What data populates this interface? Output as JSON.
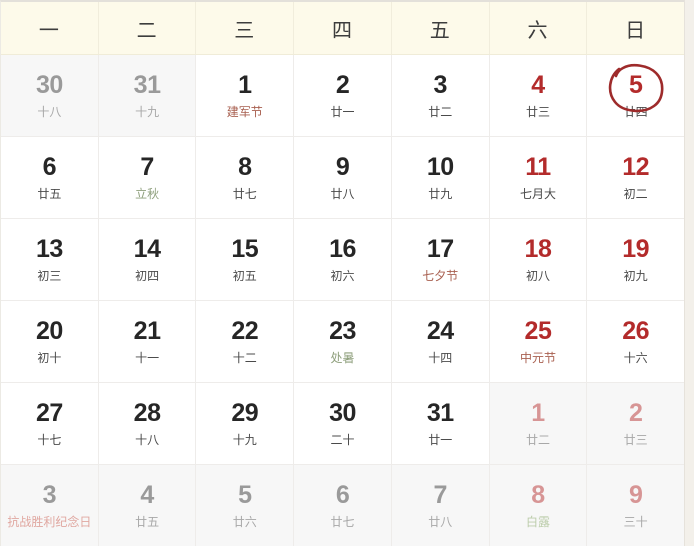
{
  "colors": {
    "header_bg": "#fdfaea",
    "cell_bg": "#ffffff",
    "other_month_bg": "#f7f7f7",
    "weekday_text": "#3d3d3d",
    "day_text": "#262626",
    "weekend_day_text": "#b32b2b",
    "other_month_day_text": "#9a9a9a",
    "other_month_weekend_text": "#d79595",
    "lunar_text": "#4a4a4a",
    "festival_text": "#a85f4f",
    "solar_term_text": "#8fa07d",
    "highlight_circle": "#9e2b2b",
    "grid_line": "#eeecea",
    "page_bg": "#f3f0ea"
  },
  "header": {
    "weekdays": [
      {
        "label": "一",
        "weekend": false
      },
      {
        "label": "二",
        "weekend": false
      },
      {
        "label": "三",
        "weekend": false
      },
      {
        "label": "四",
        "weekend": false
      },
      {
        "label": "五",
        "weekend": false
      },
      {
        "label": "六",
        "weekend": true
      },
      {
        "label": "日",
        "weekend": true
      }
    ]
  },
  "weeks": [
    [
      {
        "day": "30",
        "sub": "十八",
        "sub_type": "lunar",
        "other_month": true,
        "weekend": false,
        "today": false
      },
      {
        "day": "31",
        "sub": "十九",
        "sub_type": "lunar",
        "other_month": true,
        "weekend": false,
        "today": false
      },
      {
        "day": "1",
        "sub": "建军节",
        "sub_type": "festival",
        "other_month": false,
        "weekend": false,
        "today": false
      },
      {
        "day": "2",
        "sub": "廿一",
        "sub_type": "lunar",
        "other_month": false,
        "weekend": false,
        "today": false
      },
      {
        "day": "3",
        "sub": "廿二",
        "sub_type": "lunar",
        "other_month": false,
        "weekend": false,
        "today": false
      },
      {
        "day": "4",
        "sub": "廿三",
        "sub_type": "lunar",
        "other_month": false,
        "weekend": true,
        "today": false
      },
      {
        "day": "5",
        "sub": "廿四",
        "sub_type": "lunar",
        "other_month": false,
        "weekend": true,
        "today": true
      }
    ],
    [
      {
        "day": "6",
        "sub": "廿五",
        "sub_type": "lunar",
        "other_month": false,
        "weekend": false,
        "today": false
      },
      {
        "day": "7",
        "sub": "立秋",
        "sub_type": "term",
        "other_month": false,
        "weekend": false,
        "today": false
      },
      {
        "day": "8",
        "sub": "廿七",
        "sub_type": "lunar",
        "other_month": false,
        "weekend": false,
        "today": false
      },
      {
        "day": "9",
        "sub": "廿八",
        "sub_type": "lunar",
        "other_month": false,
        "weekend": false,
        "today": false
      },
      {
        "day": "10",
        "sub": "廿九",
        "sub_type": "lunar",
        "other_month": false,
        "weekend": false,
        "today": false
      },
      {
        "day": "11",
        "sub": "七月大",
        "sub_type": "lunar",
        "other_month": false,
        "weekend": true,
        "today": false
      },
      {
        "day": "12",
        "sub": "初二",
        "sub_type": "lunar",
        "other_month": false,
        "weekend": true,
        "today": false
      }
    ],
    [
      {
        "day": "13",
        "sub": "初三",
        "sub_type": "lunar",
        "other_month": false,
        "weekend": false,
        "today": false
      },
      {
        "day": "14",
        "sub": "初四",
        "sub_type": "lunar",
        "other_month": false,
        "weekend": false,
        "today": false
      },
      {
        "day": "15",
        "sub": "初五",
        "sub_type": "lunar",
        "other_month": false,
        "weekend": false,
        "today": false
      },
      {
        "day": "16",
        "sub": "初六",
        "sub_type": "lunar",
        "other_month": false,
        "weekend": false,
        "today": false
      },
      {
        "day": "17",
        "sub": "七夕节",
        "sub_type": "festival",
        "other_month": false,
        "weekend": false,
        "today": false
      },
      {
        "day": "18",
        "sub": "初八",
        "sub_type": "lunar",
        "other_month": false,
        "weekend": true,
        "today": false
      },
      {
        "day": "19",
        "sub": "初九",
        "sub_type": "lunar",
        "other_month": false,
        "weekend": true,
        "today": false
      }
    ],
    [
      {
        "day": "20",
        "sub": "初十",
        "sub_type": "lunar",
        "other_month": false,
        "weekend": false,
        "today": false
      },
      {
        "day": "21",
        "sub": "十一",
        "sub_type": "lunar",
        "other_month": false,
        "weekend": false,
        "today": false
      },
      {
        "day": "22",
        "sub": "十二",
        "sub_type": "lunar",
        "other_month": false,
        "weekend": false,
        "today": false
      },
      {
        "day": "23",
        "sub": "处暑",
        "sub_type": "term",
        "other_month": false,
        "weekend": false,
        "today": false
      },
      {
        "day": "24",
        "sub": "十四",
        "sub_type": "lunar",
        "other_month": false,
        "weekend": false,
        "today": false
      },
      {
        "day": "25",
        "sub": "中元节",
        "sub_type": "festival",
        "other_month": false,
        "weekend": true,
        "today": false
      },
      {
        "day": "26",
        "sub": "十六",
        "sub_type": "lunar",
        "other_month": false,
        "weekend": true,
        "today": false
      }
    ],
    [
      {
        "day": "27",
        "sub": "十七",
        "sub_type": "lunar",
        "other_month": false,
        "weekend": false,
        "today": false
      },
      {
        "day": "28",
        "sub": "十八",
        "sub_type": "lunar",
        "other_month": false,
        "weekend": false,
        "today": false
      },
      {
        "day": "29",
        "sub": "十九",
        "sub_type": "lunar",
        "other_month": false,
        "weekend": false,
        "today": false
      },
      {
        "day": "30",
        "sub": "二十",
        "sub_type": "lunar",
        "other_month": false,
        "weekend": false,
        "today": false
      },
      {
        "day": "31",
        "sub": "廿一",
        "sub_type": "lunar",
        "other_month": false,
        "weekend": false,
        "today": false
      },
      {
        "day": "1",
        "sub": "廿二",
        "sub_type": "lunar",
        "other_month": true,
        "weekend": true,
        "today": false
      },
      {
        "day": "2",
        "sub": "廿三",
        "sub_type": "lunar",
        "other_month": true,
        "weekend": true,
        "today": false
      }
    ],
    [
      {
        "day": "3",
        "sub": "抗战胜利纪念日",
        "sub_type": "festival",
        "other_month": true,
        "weekend": false,
        "today": false
      },
      {
        "day": "4",
        "sub": "廿五",
        "sub_type": "lunar",
        "other_month": true,
        "weekend": false,
        "today": false
      },
      {
        "day": "5",
        "sub": "廿六",
        "sub_type": "lunar",
        "other_month": true,
        "weekend": false,
        "today": false
      },
      {
        "day": "6",
        "sub": "廿七",
        "sub_type": "lunar",
        "other_month": true,
        "weekend": false,
        "today": false
      },
      {
        "day": "7",
        "sub": "廿八",
        "sub_type": "lunar",
        "other_month": true,
        "weekend": false,
        "today": false
      },
      {
        "day": "8",
        "sub": "白露",
        "sub_type": "term",
        "other_month": true,
        "weekend": true,
        "today": false
      },
      {
        "day": "9",
        "sub": "三十",
        "sub_type": "lunar",
        "other_month": true,
        "weekend": true,
        "today": false
      }
    ]
  ]
}
